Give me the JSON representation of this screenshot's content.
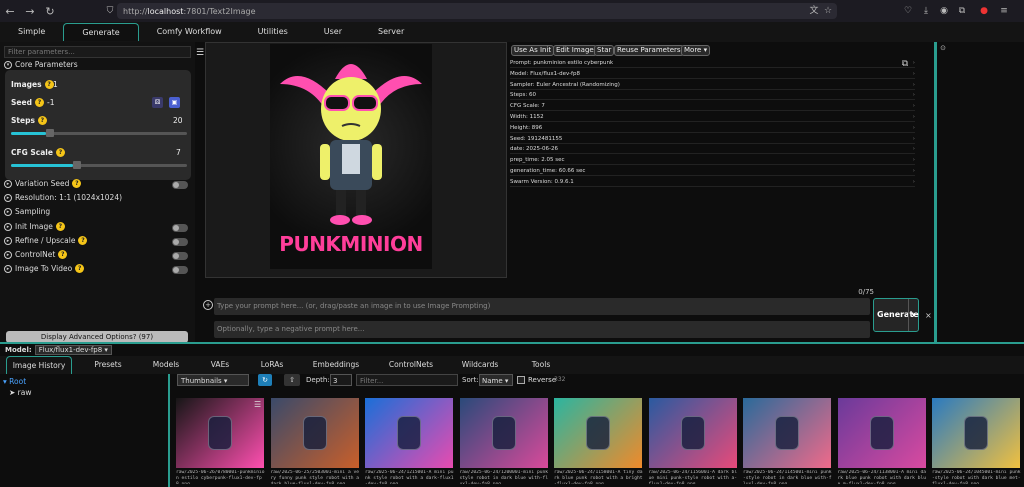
{
  "browser": {
    "url_prefix": "http://",
    "url_host": "localhost",
    "url_rest": ":7801/Text2Image"
  },
  "top_tabs": [
    "Simple",
    "Generate",
    "Comfy Workflow",
    "Utilities",
    "User",
    "Server"
  ],
  "active_top_tab": "Generate",
  "left": {
    "filter_placeholder": "Filter parameters...",
    "core_title": "Core Parameters",
    "images_label": "Images",
    "images_value": "1",
    "seed_label": "Seed",
    "seed_value": "-1",
    "steps_label": "Steps",
    "steps_value": "20",
    "steps_fraction": 0.2,
    "cfg_label": "CFG Scale",
    "cfg_value": "7",
    "cfg_fraction": 0.35,
    "sections": [
      {
        "label": "Variation Seed",
        "q": true,
        "toggle": true
      },
      {
        "label": "Resolution: 1:1 (1024x1024)",
        "q": false,
        "toggle": false
      },
      {
        "label": "Sampling",
        "q": false,
        "toggle": false
      },
      {
        "label": "Init Image",
        "q": true,
        "toggle": true
      },
      {
        "label": "Refine / Upscale",
        "q": true,
        "toggle": true
      },
      {
        "label": "ControlNet",
        "q": true,
        "toggle": true
      },
      {
        "label": "Image To Video",
        "q": true,
        "toggle": true
      }
    ],
    "advanced_label": "Display Advanced Options? (97)"
  },
  "image": {
    "text": "PUNKMINION"
  },
  "meta_buttons": [
    "Use As Init",
    "Edit Image",
    "Star",
    "Reuse Parameters",
    "More ▾"
  ],
  "metadata": [
    "Prompt: punkminion estilo cyberpunk",
    "Model: Flux/flux1-dev-fp8",
    "Sampler: Euler Ancestral (Randomizing)",
    "Steps: 60",
    "CFG Scale: 7",
    "Width: 1152",
    "Height: 896",
    "Seed: 1912481155",
    "date: 2025-06-26",
    "prep_time: 2.05 sec",
    "generation_time: 60.66 sec",
    "Swarm Version: 0.9.6.1"
  ],
  "prompt": {
    "counter": "0/75",
    "placeholder": "Type your prompt here... (or, drag/paste an image in to use Image Prompting)",
    "negative_placeholder": "Optionally, type a negative prompt here...",
    "generate_label": "Generate",
    "caret": "▾",
    "close": "×"
  },
  "model_bar": {
    "label": "Model:",
    "value": "Flux/flux1-dev-fp8 ▾"
  },
  "bottom_tabs": [
    "Image History",
    "Presets",
    "Models",
    "VAEs",
    "LoRAs",
    "Embeddings",
    "ControlNets",
    "Wildcards",
    "Tools"
  ],
  "tree": {
    "root": "Root",
    "child": "raw"
  },
  "history_toolbar": {
    "view": "Thumbnails ▾",
    "depth_label": "Depth:",
    "depth_value": "3",
    "filter_placeholder": "Filter...",
    "sort_label": "Sort:",
    "sort_value": "Name ▾",
    "reverse_label": "Reverse",
    "count": "332"
  },
  "thumbnails": [
    {
      "caption": "raw/2025-06-26/0780001-punkminion estilo cyberpunk-flux1-dev-fp8.png",
      "c1": "#161616",
      "c2": "#ff4fb0"
    },
    {
      "caption": "raw/2025-06-25/2503001-mini a very funny punk style robot with a dark blue-flux1-dev-fp8.png",
      "c1": "#3a4a6a",
      "c2": "#c95f2a"
    },
    {
      "caption": "raw/2025-06-24/1215001-A mini punk style robot with a dark-flux1-dev-fp8.png",
      "c1": "#1a6fd8",
      "c2": "#e84bb0"
    },
    {
      "caption": "raw/2025-06-24/1200001-mini punk style robot in dark blue with-flux1-dev-fp8.png",
      "c1": "#2a4a7a",
      "c2": "#d94a9a"
    },
    {
      "caption": "raw/2025-06-24/1158001-A tiny dark blue punk robot with a bright-flux1-dev-fp8.png",
      "c1": "#2bb5a0",
      "c2": "#f08a2a"
    },
    {
      "caption": "raw/2025-06-24/1156001-A dark blue mini punk-style robot with a-flux1-dev-fp8.png",
      "c1": "#2a5aa0",
      "c2": "#e84a7a"
    },
    {
      "caption": "raw/2025-06-24/1145001-mini punk-style robot in dark blue with-flux1-dev-fp8.png",
      "c1": "#2a6a9a",
      "c2": "#f06a8a"
    },
    {
      "caption": "raw/2025-06-24/1138001-A mini dark blue punk robot with dark blue m-flux1-dev-fp8.png",
      "c1": "#6a3a9a",
      "c2": "#d94aa0"
    },
    {
      "caption": "raw/2025-06-24/1045001-mini punk-style robot with dark blue met-flux1-dev-fp8.png",
      "c1": "#2a7ac0",
      "c2": "#f0c040"
    }
  ]
}
